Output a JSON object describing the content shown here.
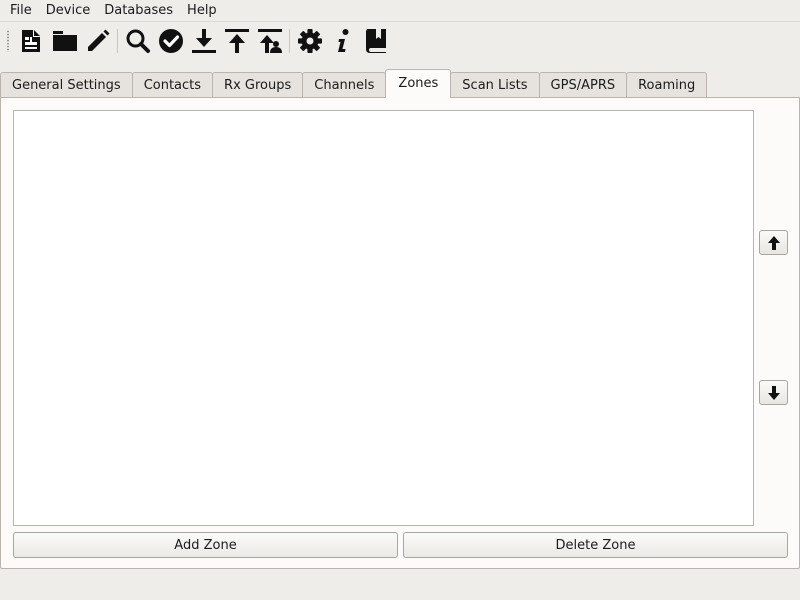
{
  "menubar": {
    "items": [
      {
        "label": "File"
      },
      {
        "label": "Device"
      },
      {
        "label": "Databases"
      },
      {
        "label": "Help"
      }
    ]
  },
  "toolbar": {
    "icons": [
      "new-codeplug-icon",
      "open-folder-icon",
      "edit-pencil-icon",
      "search-device-icon",
      "verify-check-icon",
      "download-icon",
      "upload-icon",
      "upload-callsign-db-icon",
      "settings-gear-icon",
      "info-icon",
      "user-manual-book-icon"
    ]
  },
  "tabs": [
    {
      "label": "General Settings"
    },
    {
      "label": "Contacts"
    },
    {
      "label": "Rx Groups"
    },
    {
      "label": "Channels"
    },
    {
      "label": "Zones",
      "active": true
    },
    {
      "label": "Scan Lists"
    },
    {
      "label": "GPS/APRS"
    },
    {
      "label": "Roaming"
    }
  ],
  "zones": {
    "add_label": "Add Zone",
    "delete_label": "Delete Zone",
    "items": []
  }
}
